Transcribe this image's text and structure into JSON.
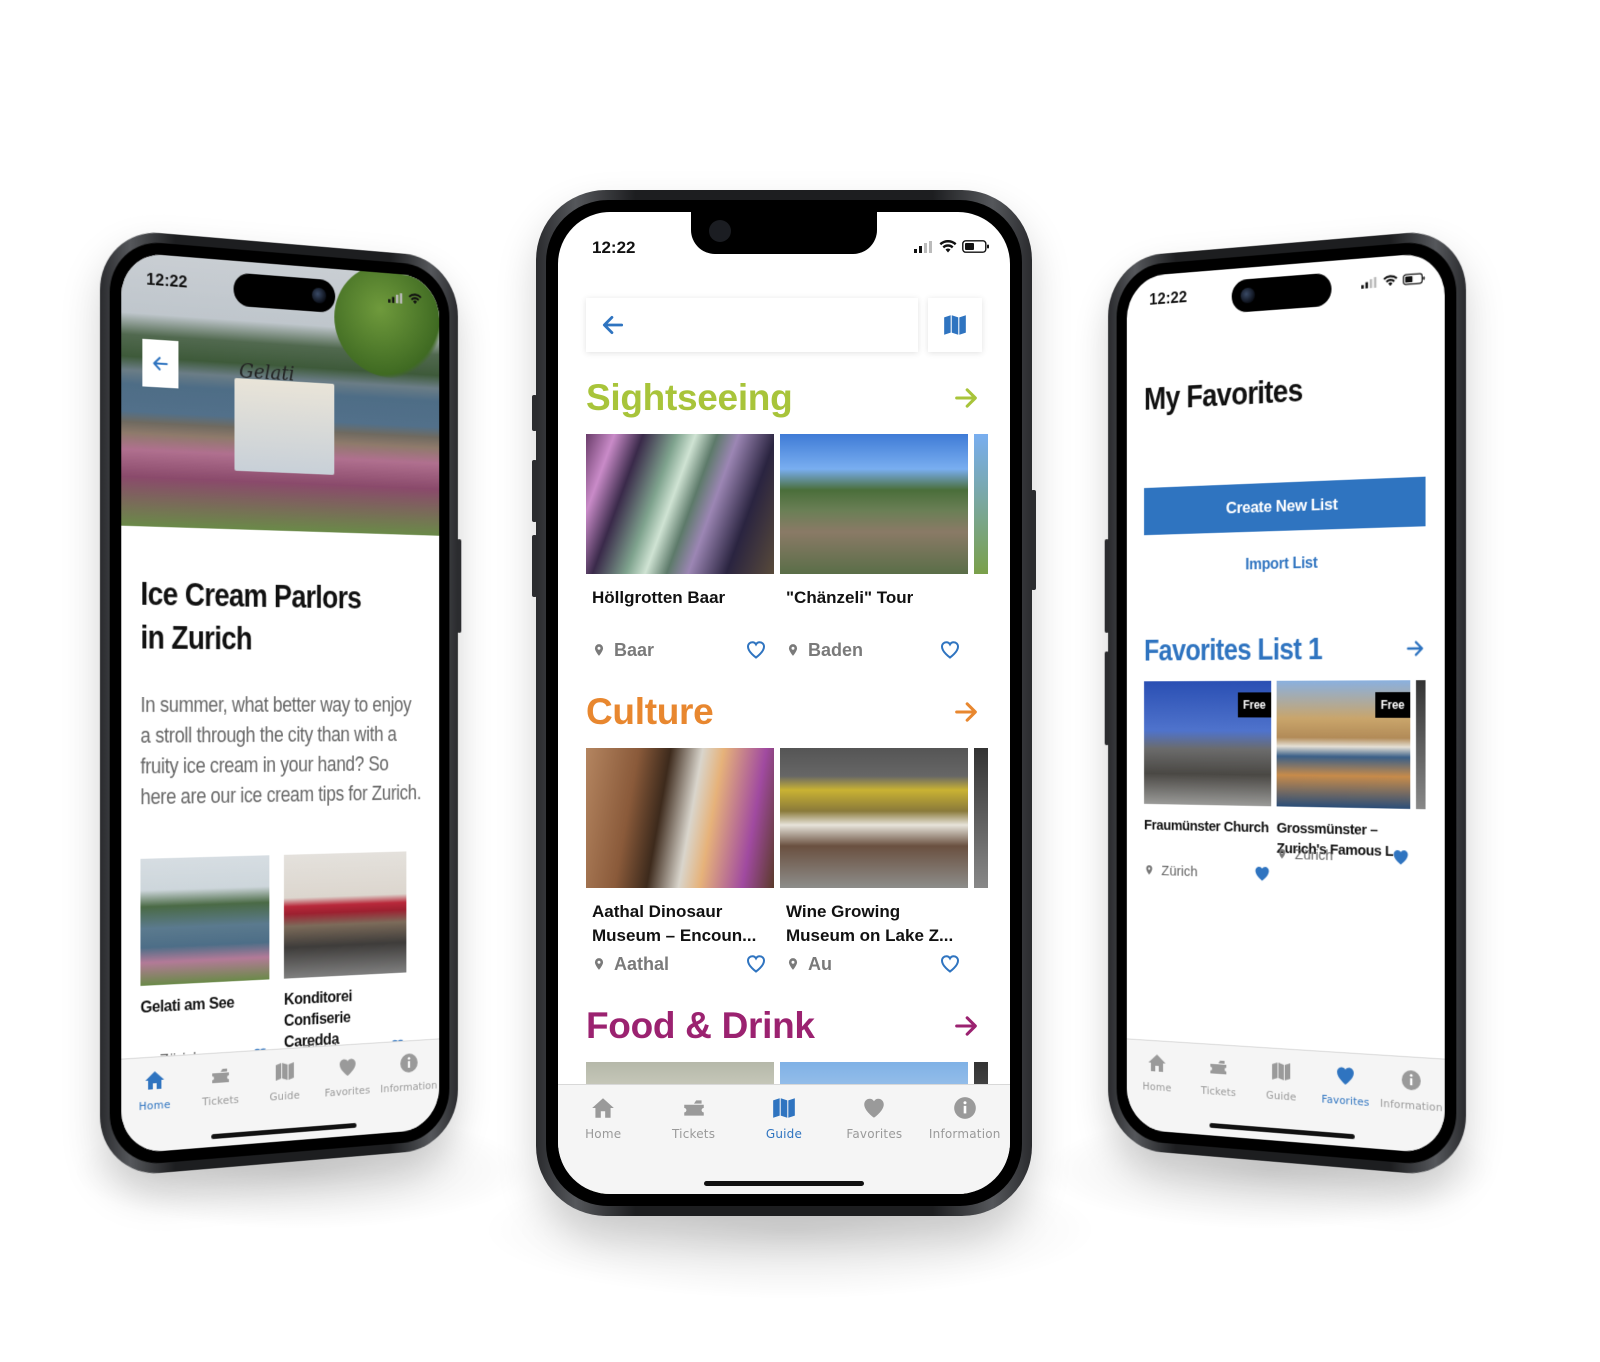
{
  "status_bar": {
    "time": "12:22"
  },
  "tabbar": {
    "items": [
      {
        "label": "Home",
        "icon": "home-icon"
      },
      {
        "label": "Tickets",
        "icon": "ticket-icon"
      },
      {
        "label": "Guide",
        "icon": "map-icon"
      },
      {
        "label": "Favorites",
        "icon": "heart-icon"
      },
      {
        "label": "Information",
        "icon": "info-icon"
      }
    ]
  },
  "colors": {
    "accent_blue": "#2f74c0",
    "sightseeing": "#a8c43a",
    "culture": "#e8872f",
    "food_drink": "#9b2270",
    "inactive_tab": "#9a9a9a"
  },
  "left_phone": {
    "active_tab": "Home",
    "article": {
      "title_line1": "Ice Cream Parlors",
      "title_line2": "in Zurich",
      "body": "In summer, what better way to enjoy a stroll through the city than with a fruity ice cream in your hand? So here are our ice cream tips for Zurich."
    },
    "cards": [
      {
        "title": "Gelati am See",
        "location": "Zürich"
      },
      {
        "title": "Konditorei Confiserie Caredda",
        "location": "Zürich"
      }
    ],
    "hero_sign": "Gelati"
  },
  "center_phone": {
    "active_tab": "Guide",
    "search": {
      "placeholder": ""
    },
    "sections": [
      {
        "title": "Sightseeing",
        "cards": [
          {
            "title": "Höllgrotten Baar",
            "location": "Baar"
          },
          {
            "title": "\"Chänzeli\" Tour",
            "location": "Baden"
          }
        ]
      },
      {
        "title": "Culture",
        "cards": [
          {
            "title_line1": "Aathal Dinosaur",
            "title_line2": "Museum – Encoun...",
            "location": "Aathal"
          },
          {
            "title_line1": "Wine Growing",
            "title_line2": "Museum on Lake Z...",
            "location": "Au"
          }
        ]
      },
      {
        "title": "Food & Drink"
      }
    ]
  },
  "right_phone": {
    "active_tab": "Favorites",
    "page_title": "My Favorites",
    "create_button": "Create New List",
    "import_link": "Import List",
    "list": {
      "title": "Favorites List 1",
      "cards": [
        {
          "title_line1": "Fraumünster Church",
          "title_line2": "",
          "location": "Zürich",
          "badge": "Free"
        },
        {
          "title_line1": "Grossmünster –",
          "title_line2": "Zurich's Famous L...",
          "location": "Zürich",
          "badge": "Free"
        }
      ]
    }
  }
}
